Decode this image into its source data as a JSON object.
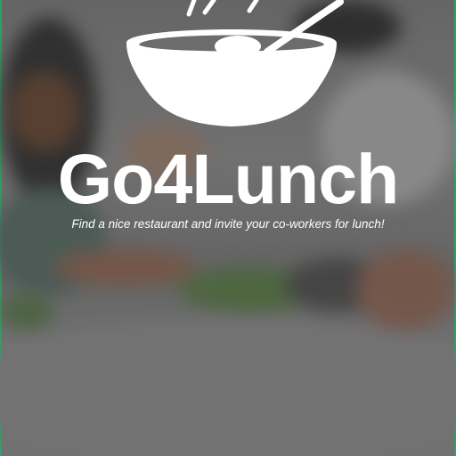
{
  "app": {
    "title": "Go4Lunch",
    "tagline": "Find a nice restaurant and invite your co-workers for lunch!"
  },
  "icons": {
    "logo": "soup-bowl-with-spoon-icon"
  },
  "colors": {
    "text": "#ffffff",
    "edge_accent": "#3ec27d"
  }
}
